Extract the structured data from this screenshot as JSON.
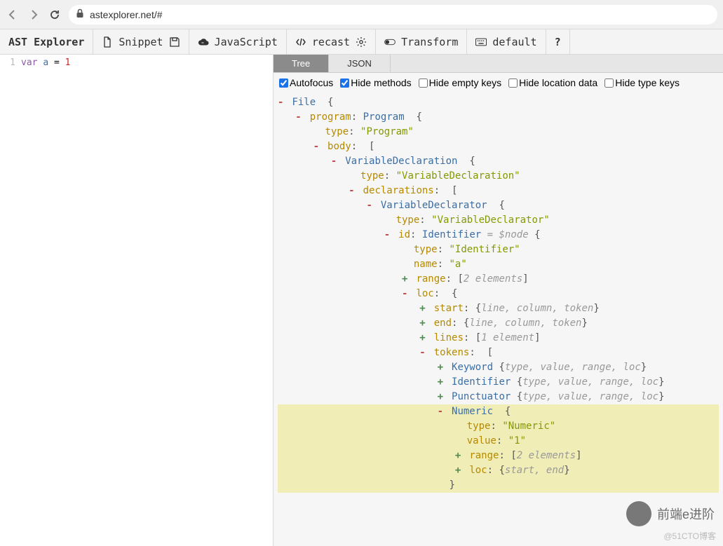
{
  "browser": {
    "url": "astexplorer.net/#"
  },
  "toolbar": {
    "brand": "AST Explorer",
    "snippet": "Snippet",
    "lang": "JavaScript",
    "parser": "recast",
    "transform": "Transform",
    "keybind": "default"
  },
  "editor": {
    "line_no": "1",
    "kw": "var",
    "ident": "a",
    "eq": "=",
    "lit": "1"
  },
  "tabs": {
    "tree": "Tree",
    "json": "JSON"
  },
  "options": {
    "autofocus": "Autofocus",
    "hide_methods": "Hide methods",
    "hide_empty": "Hide empty keys",
    "hide_loc": "Hide location data",
    "hide_type": "Hide type keys",
    "autofocus_checked": true,
    "hide_methods_checked": true,
    "hide_empty_checked": false,
    "hide_loc_checked": false,
    "hide_type_checked": false
  },
  "ast": {
    "file": "File",
    "program_key": "program",
    "program_node": "Program",
    "type_key": "type",
    "program_type": "\"Program\"",
    "body_key": "body",
    "vardecl_node": "VariableDeclaration",
    "vardecl_type": "\"VariableDeclaration\"",
    "declarations_key": "declarations",
    "vardeclarator_node": "VariableDeclarator",
    "vardeclarator_type": "\"VariableDeclarator\"",
    "id_key": "id",
    "identifier_node": "Identifier",
    "node_hint": "= $node",
    "identifier_type": "\"Identifier\"",
    "name_key": "name",
    "name_val": "\"a\"",
    "range_key": "range",
    "two_elements": "2 elements",
    "loc_key": "loc",
    "start_key": "start",
    "end_key": "end",
    "lct": "line, column, token",
    "lines_key": "lines",
    "one_element": "1 element",
    "tokens_key": "tokens",
    "keyword_node": "Keyword",
    "tvr": "type, value, range, loc",
    "punctuator_node": "Punctuator",
    "numeric_node": "Numeric",
    "numeric_type": "\"Numeric\"",
    "value_key": "value",
    "value_val": "\"1\"",
    "se": "start, end"
  },
  "watermark": {
    "text": "前端e进阶",
    "sub": "@51CTO博客"
  }
}
